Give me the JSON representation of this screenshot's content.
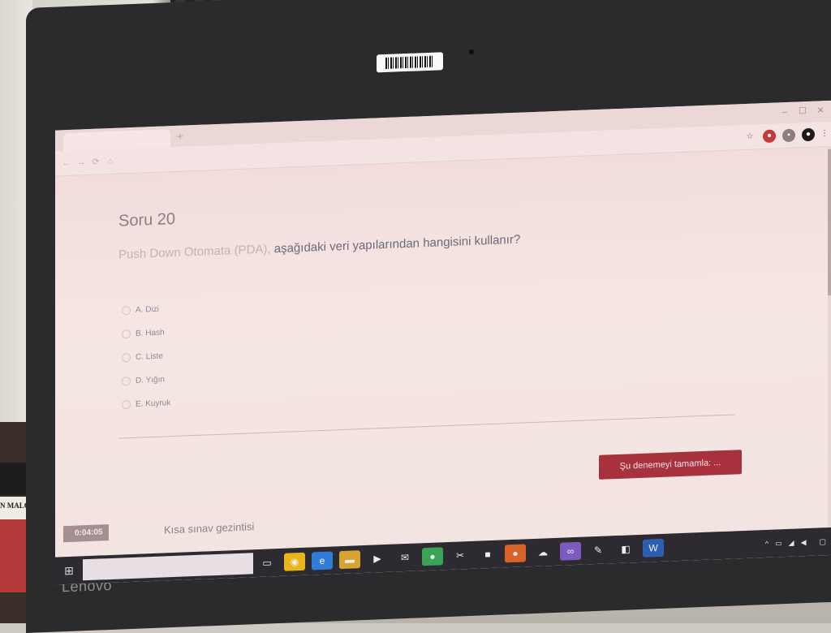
{
  "environment": {
    "book_title": "N MALO",
    "laptop_brand": "Lenovo"
  },
  "browser": {
    "tab_title": "",
    "address": "",
    "icons": [
      "star-icon",
      "record-icon",
      "extensions-icon",
      "profile-icon",
      "menu-icon"
    ]
  },
  "window": {
    "minimize": "–",
    "maximize": "☐",
    "close": "✕"
  },
  "question": {
    "number": "Soru 20",
    "info_items": [
      "",
      "",
      ""
    ],
    "text_prefix": "Push Down Otomata (PDA),",
    "text_main": " aşağıdaki veri yapılarından hangisini kullanır?",
    "choose_label": "",
    "options": [
      {
        "label": "A. Dizi"
      },
      {
        "label": "B. Hash"
      },
      {
        "label": "C. Liste"
      },
      {
        "label": "D. Yığın"
      },
      {
        "label": "E. Kuyruk"
      }
    ]
  },
  "finish_button": "Şu denemeyi tamamla: ...",
  "timer": {
    "label": "",
    "value": "0:04:05"
  },
  "quiz_nav": "Kısa sınav gezintisi",
  "taskbar": {
    "search_placeholder": "",
    "time": "",
    "date": "",
    "colors": {
      "chrome": "#e8b51a",
      "edge": "#2f7dd6",
      "files": "#d8a431",
      "green": "#3aa356",
      "orange": "#d9622b",
      "vs": "#7c5bbf",
      "word": "#2b5fb3"
    }
  },
  "colors": {
    "accent": "#a8313e",
    "question_text": "#6c6a78"
  }
}
